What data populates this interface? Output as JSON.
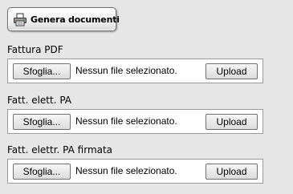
{
  "actions": {
    "generate_label": "Genera documenti",
    "generate_icon": "printer-icon"
  },
  "sections": [
    {
      "label": "Fattura PDF",
      "browse_label": "Sfoglia...",
      "status": "Nessun file selezionato.",
      "upload_label": "Upload"
    },
    {
      "label": "Fatt. elett. PA",
      "browse_label": "Sfoglia...",
      "status": "Nessun file selezionato.",
      "upload_label": "Upload"
    },
    {
      "label": "Fatt. elettr. PA firmata",
      "browse_label": "Sfoglia...",
      "status": "Nessun file selezionato.",
      "upload_label": "Upload"
    }
  ]
}
